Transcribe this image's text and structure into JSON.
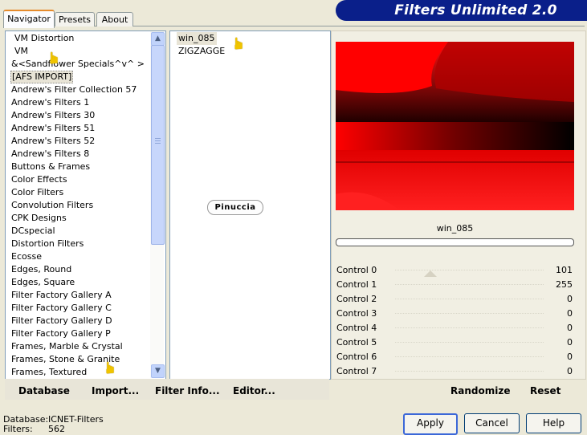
{
  "banner": {
    "title": "Filters Unlimited 2.0"
  },
  "tabs": [
    {
      "label": "Navigator",
      "active": true
    },
    {
      "label": "Presets",
      "active": false
    },
    {
      "label": "About",
      "active": false
    }
  ],
  "categories": [
    "VM Distortion",
    "VM",
    "&<Sandflower Specials^v^ >",
    "[AFS IMPORT]",
    "Andrew's Filter Collection 57",
    "Andrew's Filters 1",
    "Andrew's Filters 30",
    "Andrew's Filters 51",
    "Andrew's Filters 52",
    "Andrew's Filters 8",
    "Buttons & Frames",
    "Color Effects",
    "Color Filters",
    "Convolution Filters",
    "CPK Designs",
    "DCspecial",
    "Distortion Filters",
    "Ecosse",
    "Edges, Round",
    "Edges, Square",
    "Filter Factory Gallery A",
    "Filter Factory Gallery C",
    "Filter Factory Gallery D",
    "Filter Factory Gallery P",
    "Frames, Marble & Crystal",
    "Frames, Stone & Granite",
    "Frames, Textured"
  ],
  "selected_category": "[AFS IMPORT]",
  "filters": [
    "win_085",
    "ZIGZAGGE"
  ],
  "selected_filter": "win_085",
  "watermark": "Pinuccia",
  "toolbar": {
    "database": "Database",
    "import": "Import...",
    "filter_info": "Filter Info...",
    "editor": "Editor...",
    "randomize": "Randomize",
    "reset": "Reset"
  },
  "preview": {
    "filter_name": "win_085"
  },
  "controls": [
    {
      "label": "Control 0",
      "value": "101"
    },
    {
      "label": "Control 1",
      "value": "255"
    },
    {
      "label": "Control 2",
      "value": "0"
    },
    {
      "label": "Control 3",
      "value": "0"
    },
    {
      "label": "Control 4",
      "value": "0"
    },
    {
      "label": "Control 5",
      "value": "0"
    },
    {
      "label": "Control 6",
      "value": "0"
    },
    {
      "label": "Control 7",
      "value": "0"
    }
  ],
  "status": {
    "database_label": "Database:",
    "database_value": "ICNET-Filters",
    "filters_label": "Filters:",
    "filters_value": "562"
  },
  "buttons": {
    "apply": "Apply",
    "cancel": "Cancel",
    "help": "Help"
  },
  "colors": {
    "banner": "#0a1f8a",
    "preview_red": "#c00000",
    "tab_accent": "#e68b2c"
  }
}
